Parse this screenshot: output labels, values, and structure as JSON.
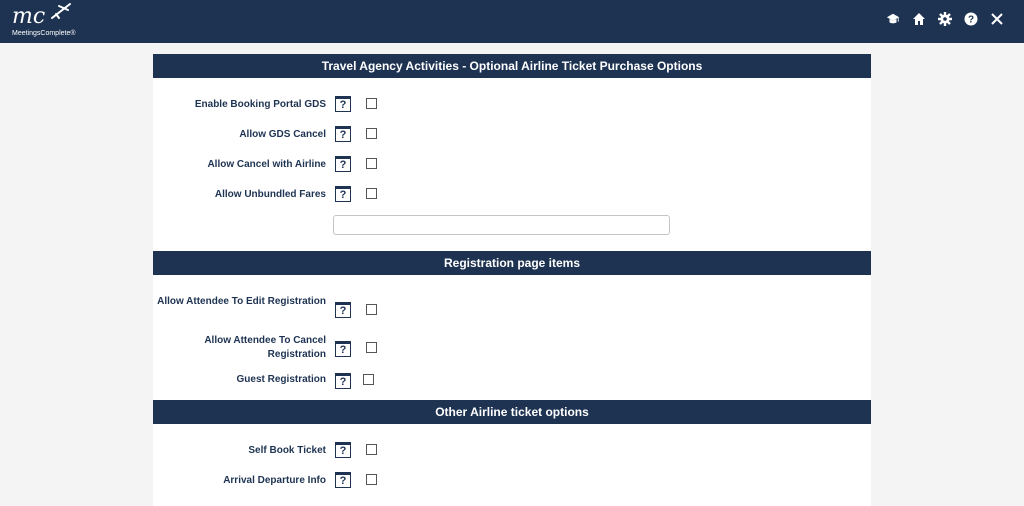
{
  "header": {
    "logo_mark": "mc",
    "logo_text": "MeetingsComplete®",
    "icons": [
      "graduation-cap-icon",
      "home-icon",
      "gear-icon",
      "help-icon",
      "close-icon"
    ]
  },
  "sections": [
    {
      "title": "Travel Agency Activities - Optional Airline Ticket Purchase Options",
      "items": [
        {
          "label": "Enable Booking Portal GDS",
          "help": "?",
          "checked": false
        },
        {
          "label": "Allow GDS Cancel",
          "help": "?",
          "checked": false
        },
        {
          "label": "Allow Cancel with Airline",
          "help": "?",
          "checked": false
        },
        {
          "label": "Allow Unbundled Fares",
          "help": "?",
          "checked": false
        }
      ],
      "input_value": ""
    },
    {
      "title": "Registration page items",
      "items": [
        {
          "label": "Allow Attendee To Edit Registration",
          "help": "?",
          "checked": false
        },
        {
          "label": "Allow Attendee To Cancel Registration",
          "help": "?",
          "checked": false
        },
        {
          "label": "Guest Registration",
          "help": "?",
          "checked": false
        }
      ]
    },
    {
      "title": "Other Airline ticket options",
      "items": [
        {
          "label": "Self Book Ticket",
          "help": "?",
          "checked": false
        },
        {
          "label": "Arrival Departure Info",
          "help": "?",
          "checked": false
        }
      ]
    }
  ],
  "colors": {
    "navy": "#1e3352",
    "page_bg": "#f4f4f4"
  }
}
